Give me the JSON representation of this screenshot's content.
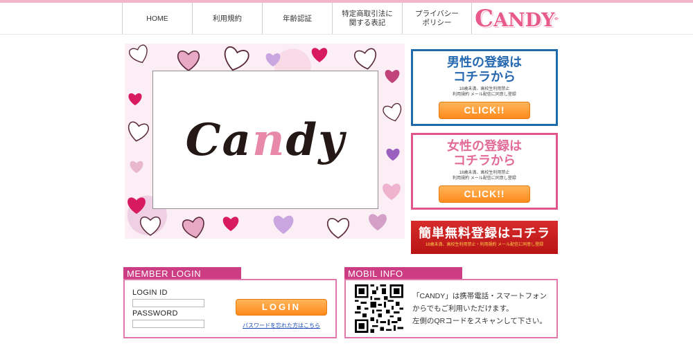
{
  "nav": {
    "items": [
      {
        "label": "HOME"
      },
      {
        "label": "利用規約"
      },
      {
        "label": "年齢認証"
      },
      {
        "label": "特定商取引法に\n関する表記"
      },
      {
        "label": "プライバシー\nポリシー"
      }
    ],
    "logo_first": "C",
    "logo_rest": "ANDY"
  },
  "hero": {
    "logo_a": "Ca",
    "logo_b": "n",
    "logo_c": "dy"
  },
  "register_male": {
    "title_line1": "男性の登録は",
    "title_line2": "コチラから",
    "note_line1": "18歳未満、高校生利用禁止",
    "note_line2": "利用規約 メール配信に同意し登録",
    "button": "CLICK!!",
    "color": "#1f6aa8"
  },
  "register_female": {
    "title_line1": "女性の登録は",
    "title_line2": "コチラから",
    "note_line1": "18歳未満、高校生利用禁止",
    "note_line2": "利用規約 メール配信に同意し登録",
    "button": "CLICK!!",
    "color": "#e0558a"
  },
  "free_register": {
    "title": "簡単無料登録はコチラ",
    "note": "18歳未満、高校生利用禁止・利用規約 メール配信に同意し登録"
  },
  "member_login": {
    "heading": "MEMBER LOGIN",
    "login_id_label": "LOGIN ID",
    "password_label": "PASSWORD",
    "button": "LOGIN",
    "forgot_link": "パスワードを忘れた方はこちら"
  },
  "mobil_info": {
    "heading": "MOBIL INFO",
    "line1": "「CANDY」は携帯電話・スマートフォン",
    "line2": "からでもご利用いただけます。",
    "line3": "左側のQRコードをスキャンして下さい。"
  },
  "colors": {
    "accent_pink": "#cc3d83",
    "button_orange": "#ff8a1c",
    "male_blue": "#1f6aa8",
    "female_pink": "#e0558a",
    "banner_red": "#c81e1e"
  }
}
